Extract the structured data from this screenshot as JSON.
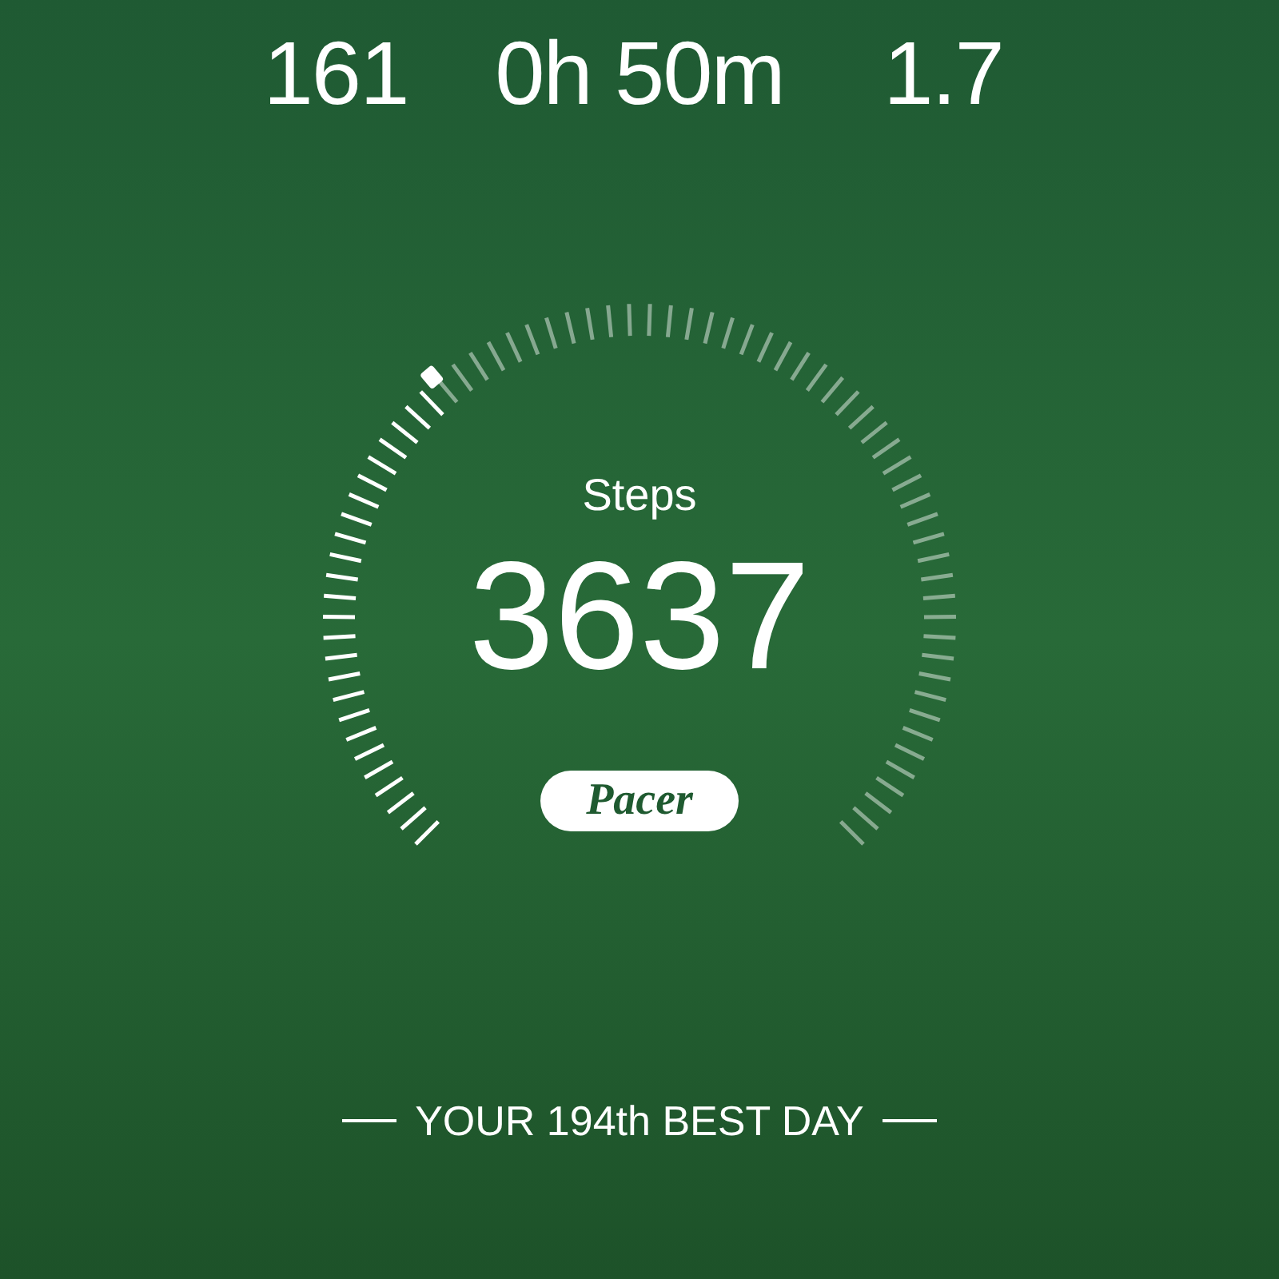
{
  "stats": [
    {
      "value": "161"
    },
    {
      "value": "0h 50m"
    },
    {
      "value": "1.7"
    }
  ],
  "steps": {
    "label": "Steps",
    "value": "3637"
  },
  "logo": "Pacer",
  "banner": "YOUR 194th BEST DAY"
}
